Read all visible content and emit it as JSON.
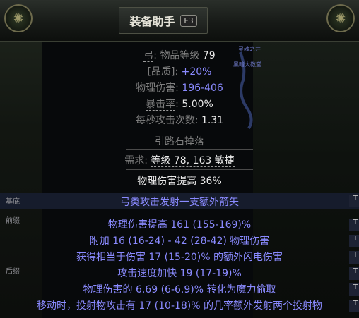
{
  "header": {
    "title": "装备助手",
    "hotkey": "F3"
  },
  "map": {
    "label1": "灵魂之井",
    "label2": "黑暗大教堂"
  },
  "item": {
    "type": "弓",
    "level_label": "物品等级",
    "level_value": "79",
    "quality_label": "[品质]",
    "quality_value": "+20%",
    "phys_label": "物理伤害",
    "phys_value": "196-406",
    "crit_label": "暴击率",
    "crit_value": "5.00%",
    "aps_label": "每秒攻击次数",
    "aps_value": "1.31",
    "drop_text": "引路石掉落",
    "req_label": "需求",
    "req_text": "等级 78, 163 敏捷",
    "implicit_text": "物理伤害提高 36%",
    "enchant": "弓类攻击发射一支额外箭矢",
    "mods": [
      "物理伤害提高 161 (155-169)%",
      "附加 16 (16-24) - 42 (28-42) 物理伤害",
      "获得相当于伤害 17 (15-20)% 的额外闪电伤害",
      "攻击速度加快 19 (17-19)%",
      "物理伤害的 6.69 (6-6.9)% 转化为魔力偷取",
      "移动时，投射物攻击有 17 (10-18)% 的几率额外发射两个投射物"
    ]
  },
  "tags": {
    "base": "基底",
    "prefix": "前缀",
    "suffix": "后缀"
  },
  "right_col": [
    "T",
    "T",
    "T",
    "T",
    "T",
    "T",
    "T"
  ],
  "colors": {
    "accent_blue": "#8a8aff",
    "header_bg": "#1a1d1a",
    "mod_band": "#161c2c"
  }
}
